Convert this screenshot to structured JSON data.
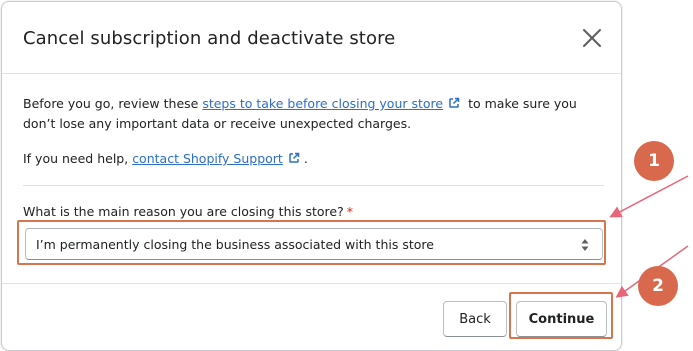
{
  "modal": {
    "title": "Cancel subscription and deactivate store",
    "close_icon": "close-icon",
    "body": {
      "intro_prefix": "Before you go, review these ",
      "intro_link": "steps to take before closing your store",
      "intro_suffix": " to make sure you don’t lose any important data or receive unexpected charges.",
      "help_prefix": "If you need help, ",
      "help_link": "contact Shopify Support",
      "help_suffix": ".",
      "external_link_icon": "external-link-icon"
    },
    "reason_field": {
      "label": "What is the main reason you are closing this store?",
      "required_marker": "*",
      "selected_value": "I’m permanently closing the business associated with this store",
      "arrow_icon": "select-arrows-icon"
    },
    "footer": {
      "back_label": "Back",
      "continue_label": "Continue"
    }
  },
  "annotations": {
    "callout_1": "1",
    "callout_2": "2",
    "highlight_color": "#d5764f",
    "callout_color": "#d9694c",
    "arrow_color": "#e8667a"
  },
  "colors": {
    "link": "#2c6ecb",
    "text": "#202223",
    "required": "#d72c0d",
    "border": "#babfc3"
  }
}
